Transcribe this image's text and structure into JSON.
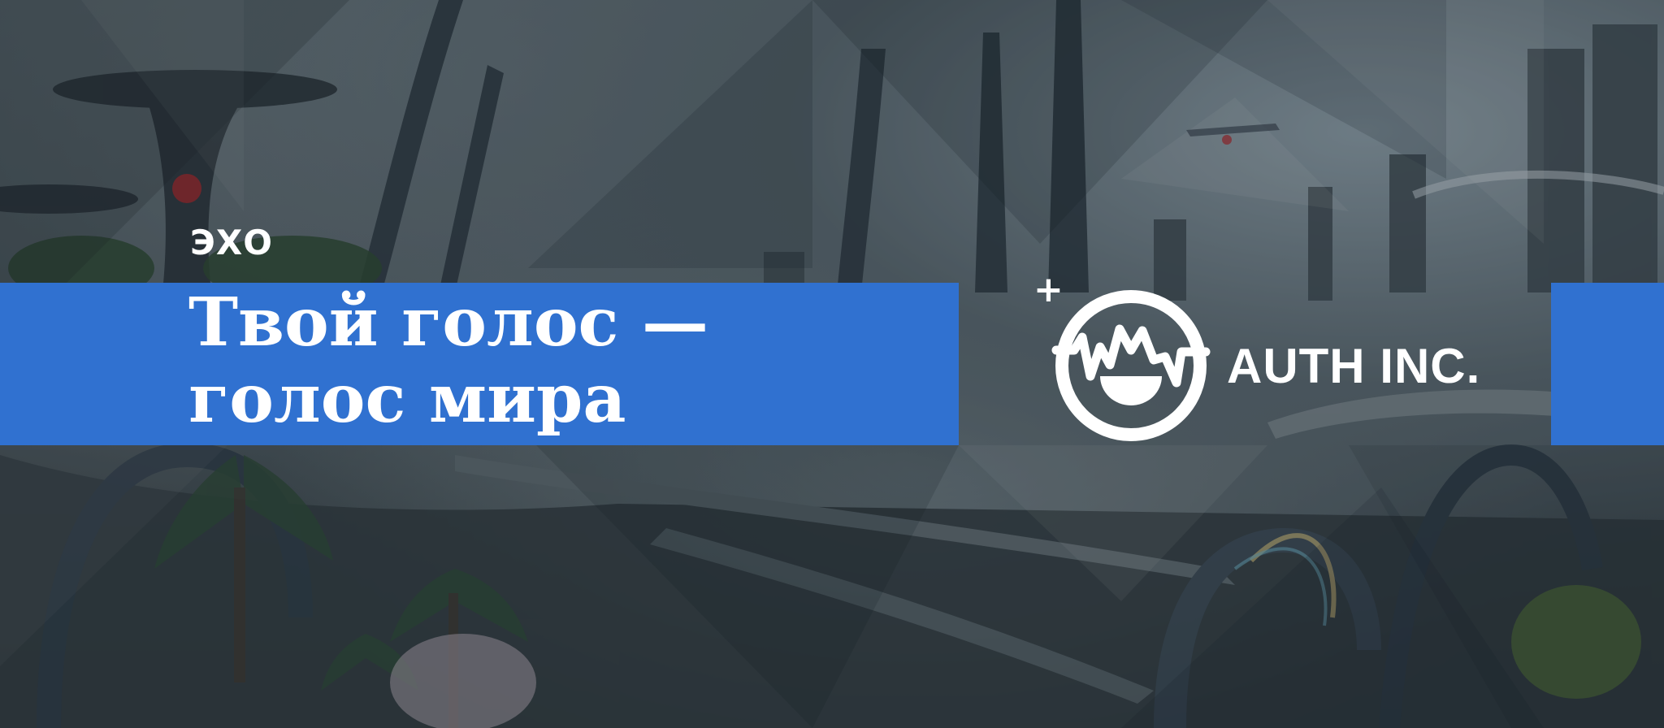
{
  "banner": {
    "eyebrow": "ЭХО",
    "headline_line1": "Твой голос —",
    "headline_line2": "голос мира"
  },
  "logo": {
    "plus": "+",
    "brand_name": "AUTH INC.",
    "icon": "sound-wave-face-circle-icon"
  },
  "colors": {
    "accent_blue": "#3071d0",
    "text": "#ffffff"
  }
}
